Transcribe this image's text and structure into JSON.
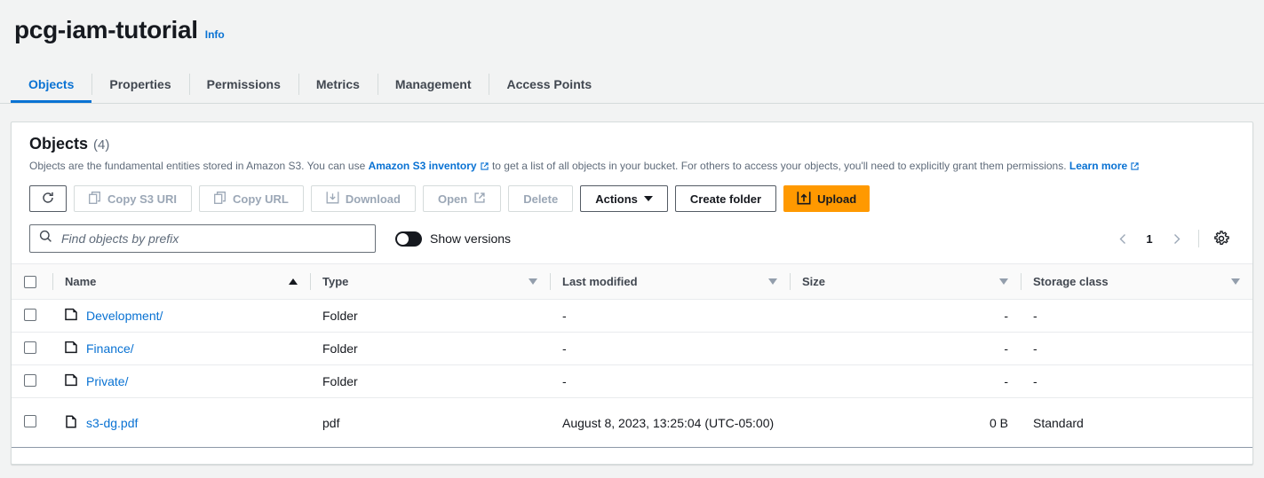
{
  "header": {
    "bucket_name": "pcg-iam-tutorial",
    "info_label": "Info"
  },
  "tabs": [
    {
      "label": "Objects",
      "active": true
    },
    {
      "label": "Properties",
      "active": false
    },
    {
      "label": "Permissions",
      "active": false
    },
    {
      "label": "Metrics",
      "active": false
    },
    {
      "label": "Management",
      "active": false
    },
    {
      "label": "Access Points",
      "active": false
    }
  ],
  "panel": {
    "title": "Objects",
    "count": "(4)",
    "description_part1": "Objects are the fundamental entities stored in Amazon S3. You can use ",
    "description_link1": "Amazon S3 inventory",
    "description_part2": " to get a list of all objects in your bucket. For others to access your objects, you'll need to explicitly grant them permissions. ",
    "description_link2": "Learn more"
  },
  "toolbar": {
    "refresh_label": "",
    "copy_s3_uri_label": "Copy S3 URI",
    "copy_url_label": "Copy URL",
    "download_label": "Download",
    "open_label": "Open",
    "delete_label": "Delete",
    "actions_label": "Actions",
    "create_folder_label": "Create folder",
    "upload_label": "Upload"
  },
  "filter": {
    "search_placeholder": "Find objects by prefix",
    "search_value": "",
    "show_versions_label": "Show versions",
    "show_versions_on": false,
    "page_number": "1"
  },
  "table": {
    "columns": [
      {
        "label": "Name",
        "sort": "asc"
      },
      {
        "label": "Type",
        "sort": "none"
      },
      {
        "label": "Last modified",
        "sort": "none"
      },
      {
        "label": "Size",
        "sort": "none"
      },
      {
        "label": "Storage class",
        "sort": "none"
      }
    ],
    "rows": [
      {
        "icon": "folder-icon",
        "name": "Development/",
        "type": "Folder",
        "last_modified": "-",
        "size": "-",
        "storage_class": "-"
      },
      {
        "icon": "folder-icon",
        "name": "Finance/",
        "type": "Folder",
        "last_modified": "-",
        "size": "-",
        "storage_class": "-"
      },
      {
        "icon": "folder-icon",
        "name": "Private/",
        "type": "Folder",
        "last_modified": "-",
        "size": "-",
        "storage_class": "-"
      },
      {
        "icon": "file-icon",
        "name": "s3-dg.pdf",
        "type": "pdf",
        "last_modified": "August 8, 2023, 13:25:04 (UTC-05:00)",
        "size": "0 B",
        "storage_class": "Standard"
      }
    ]
  },
  "colors": {
    "link": "#0972d3",
    "primary_button": "#ff9900",
    "page_background": "#f2f3f3",
    "text": "#16191f"
  }
}
